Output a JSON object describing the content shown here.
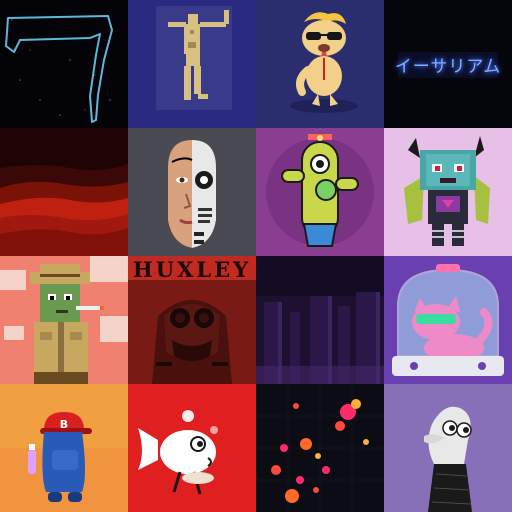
{
  "grid": {
    "tiles": [
      {
        "name": "neon-seven-scribble",
        "colors": {
          "bg": "#030308",
          "line": "#5fb8d8"
        }
      },
      {
        "name": "pixel-dancer",
        "colors": {
          "bg": "#2a2a80",
          "figure": "#d8c080"
        }
      },
      {
        "name": "cartoon-dog-sunglasses",
        "colors": {
          "bg": "#2a2e6e",
          "body": "#f2d08a",
          "hair": "#f5c542"
        }
      },
      {
        "name": "neon-katakana-sign",
        "text": "イーサリアム",
        "colors": {
          "bg": "#05050c",
          "text": "#7fb0ff"
        }
      },
      {
        "name": "red-dunes",
        "colors": {
          "sky": "#200404",
          "dune": "#c02010"
        }
      },
      {
        "name": "half-robot-face",
        "colors": {
          "bg": "#4a4a52",
          "skin": "#d9a27e"
        }
      },
      {
        "name": "cactus-robot",
        "colors": {
          "bg": "#8a3e92",
          "body": "#c8d84a"
        }
      },
      {
        "name": "voxel-horned-creature",
        "colors": {
          "bg": "#e6c0e6",
          "body": "#4aa6a6"
        }
      },
      {
        "name": "pixel-safari-zombie",
        "colors": {
          "bg": "#f08070",
          "skin": "#6a9a50",
          "hat": "#c8a860"
        }
      },
      {
        "name": "huxley-robot-cover",
        "text": "HUXLEY",
        "colors": {
          "bg": "#7a1a14",
          "title": "#1a0a08"
        }
      },
      {
        "name": "purple-city-towers",
        "colors": {
          "bg": "#1e1030",
          "tower": "#2c1848"
        }
      },
      {
        "name": "pink-cat-capsule",
        "colors": {
          "bg": "#6a40b0",
          "cat": "#ee8ac8"
        }
      },
      {
        "name": "baseball-blob-character",
        "colors": {
          "bg": "#f0a040",
          "body": "#2a5ab8"
        }
      },
      {
        "name": "white-fish-cartoon",
        "colors": {
          "bg": "#e02020",
          "fish": "#ffffff"
        }
      },
      {
        "name": "neon-bubble-dots",
        "colors": {
          "bg": "#0c0c14",
          "dot": "#ff4a3a"
        }
      },
      {
        "name": "sock-puppet-hand",
        "colors": {
          "bg": "#8870b8",
          "sock": "#e8e8e8",
          "sleeve": "#1a1a1a"
        }
      }
    ]
  }
}
